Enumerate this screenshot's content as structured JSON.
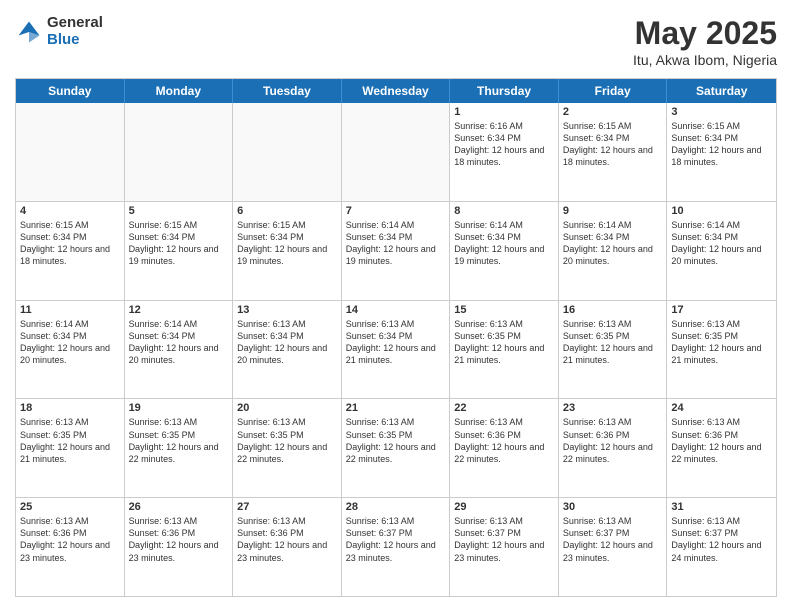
{
  "logo": {
    "general": "General",
    "blue": "Blue"
  },
  "header": {
    "month": "May 2025",
    "location": "Itu, Akwa Ibom, Nigeria"
  },
  "weekdays": [
    "Sunday",
    "Monday",
    "Tuesday",
    "Wednesday",
    "Thursday",
    "Friday",
    "Saturday"
  ],
  "weeks": [
    [
      {
        "day": "",
        "info": ""
      },
      {
        "day": "",
        "info": ""
      },
      {
        "day": "",
        "info": ""
      },
      {
        "day": "",
        "info": ""
      },
      {
        "day": "1",
        "info": "Sunrise: 6:16 AM\nSunset: 6:34 PM\nDaylight: 12 hours and 18 minutes."
      },
      {
        "day": "2",
        "info": "Sunrise: 6:15 AM\nSunset: 6:34 PM\nDaylight: 12 hours and 18 minutes."
      },
      {
        "day": "3",
        "info": "Sunrise: 6:15 AM\nSunset: 6:34 PM\nDaylight: 12 hours and 18 minutes."
      }
    ],
    [
      {
        "day": "4",
        "info": "Sunrise: 6:15 AM\nSunset: 6:34 PM\nDaylight: 12 hours and 18 minutes."
      },
      {
        "day": "5",
        "info": "Sunrise: 6:15 AM\nSunset: 6:34 PM\nDaylight: 12 hours and 19 minutes."
      },
      {
        "day": "6",
        "info": "Sunrise: 6:15 AM\nSunset: 6:34 PM\nDaylight: 12 hours and 19 minutes."
      },
      {
        "day": "7",
        "info": "Sunrise: 6:14 AM\nSunset: 6:34 PM\nDaylight: 12 hours and 19 minutes."
      },
      {
        "day": "8",
        "info": "Sunrise: 6:14 AM\nSunset: 6:34 PM\nDaylight: 12 hours and 19 minutes."
      },
      {
        "day": "9",
        "info": "Sunrise: 6:14 AM\nSunset: 6:34 PM\nDaylight: 12 hours and 20 minutes."
      },
      {
        "day": "10",
        "info": "Sunrise: 6:14 AM\nSunset: 6:34 PM\nDaylight: 12 hours and 20 minutes."
      }
    ],
    [
      {
        "day": "11",
        "info": "Sunrise: 6:14 AM\nSunset: 6:34 PM\nDaylight: 12 hours and 20 minutes."
      },
      {
        "day": "12",
        "info": "Sunrise: 6:14 AM\nSunset: 6:34 PM\nDaylight: 12 hours and 20 minutes."
      },
      {
        "day": "13",
        "info": "Sunrise: 6:13 AM\nSunset: 6:34 PM\nDaylight: 12 hours and 20 minutes."
      },
      {
        "day": "14",
        "info": "Sunrise: 6:13 AM\nSunset: 6:34 PM\nDaylight: 12 hours and 21 minutes."
      },
      {
        "day": "15",
        "info": "Sunrise: 6:13 AM\nSunset: 6:35 PM\nDaylight: 12 hours and 21 minutes."
      },
      {
        "day": "16",
        "info": "Sunrise: 6:13 AM\nSunset: 6:35 PM\nDaylight: 12 hours and 21 minutes."
      },
      {
        "day": "17",
        "info": "Sunrise: 6:13 AM\nSunset: 6:35 PM\nDaylight: 12 hours and 21 minutes."
      }
    ],
    [
      {
        "day": "18",
        "info": "Sunrise: 6:13 AM\nSunset: 6:35 PM\nDaylight: 12 hours and 21 minutes."
      },
      {
        "day": "19",
        "info": "Sunrise: 6:13 AM\nSunset: 6:35 PM\nDaylight: 12 hours and 22 minutes."
      },
      {
        "day": "20",
        "info": "Sunrise: 6:13 AM\nSunset: 6:35 PM\nDaylight: 12 hours and 22 minutes."
      },
      {
        "day": "21",
        "info": "Sunrise: 6:13 AM\nSunset: 6:35 PM\nDaylight: 12 hours and 22 minutes."
      },
      {
        "day": "22",
        "info": "Sunrise: 6:13 AM\nSunset: 6:36 PM\nDaylight: 12 hours and 22 minutes."
      },
      {
        "day": "23",
        "info": "Sunrise: 6:13 AM\nSunset: 6:36 PM\nDaylight: 12 hours and 22 minutes."
      },
      {
        "day": "24",
        "info": "Sunrise: 6:13 AM\nSunset: 6:36 PM\nDaylight: 12 hours and 22 minutes."
      }
    ],
    [
      {
        "day": "25",
        "info": "Sunrise: 6:13 AM\nSunset: 6:36 PM\nDaylight: 12 hours and 23 minutes."
      },
      {
        "day": "26",
        "info": "Sunrise: 6:13 AM\nSunset: 6:36 PM\nDaylight: 12 hours and 23 minutes."
      },
      {
        "day": "27",
        "info": "Sunrise: 6:13 AM\nSunset: 6:36 PM\nDaylight: 12 hours and 23 minutes."
      },
      {
        "day": "28",
        "info": "Sunrise: 6:13 AM\nSunset: 6:37 PM\nDaylight: 12 hours and 23 minutes."
      },
      {
        "day": "29",
        "info": "Sunrise: 6:13 AM\nSunset: 6:37 PM\nDaylight: 12 hours and 23 minutes."
      },
      {
        "day": "30",
        "info": "Sunrise: 6:13 AM\nSunset: 6:37 PM\nDaylight: 12 hours and 23 minutes."
      },
      {
        "day": "31",
        "info": "Sunrise: 6:13 AM\nSunset: 6:37 PM\nDaylight: 12 hours and 24 minutes."
      }
    ]
  ]
}
